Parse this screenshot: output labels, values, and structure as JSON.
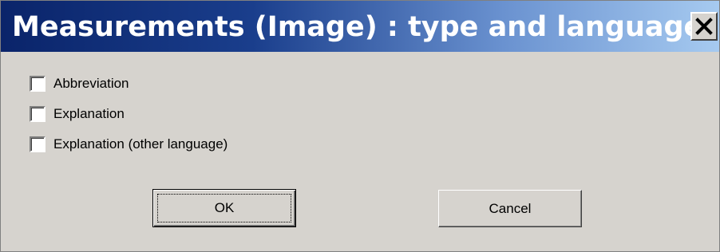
{
  "window": {
    "title": "Measurements (Image) : type and language",
    "close_icon": "close-icon"
  },
  "options": [
    {
      "label": "Abbreviation",
      "checked": false
    },
    {
      "label": "Explanation",
      "checked": false
    },
    {
      "label": "Explanation (other language)",
      "checked": false
    }
  ],
  "buttons": {
    "ok_label": "OK",
    "cancel_label": "Cancel"
  },
  "colors": {
    "title_gradient_start": "#0a246a",
    "title_gradient_end": "#a6caf0",
    "dialog_background": "#d6d3ce"
  }
}
